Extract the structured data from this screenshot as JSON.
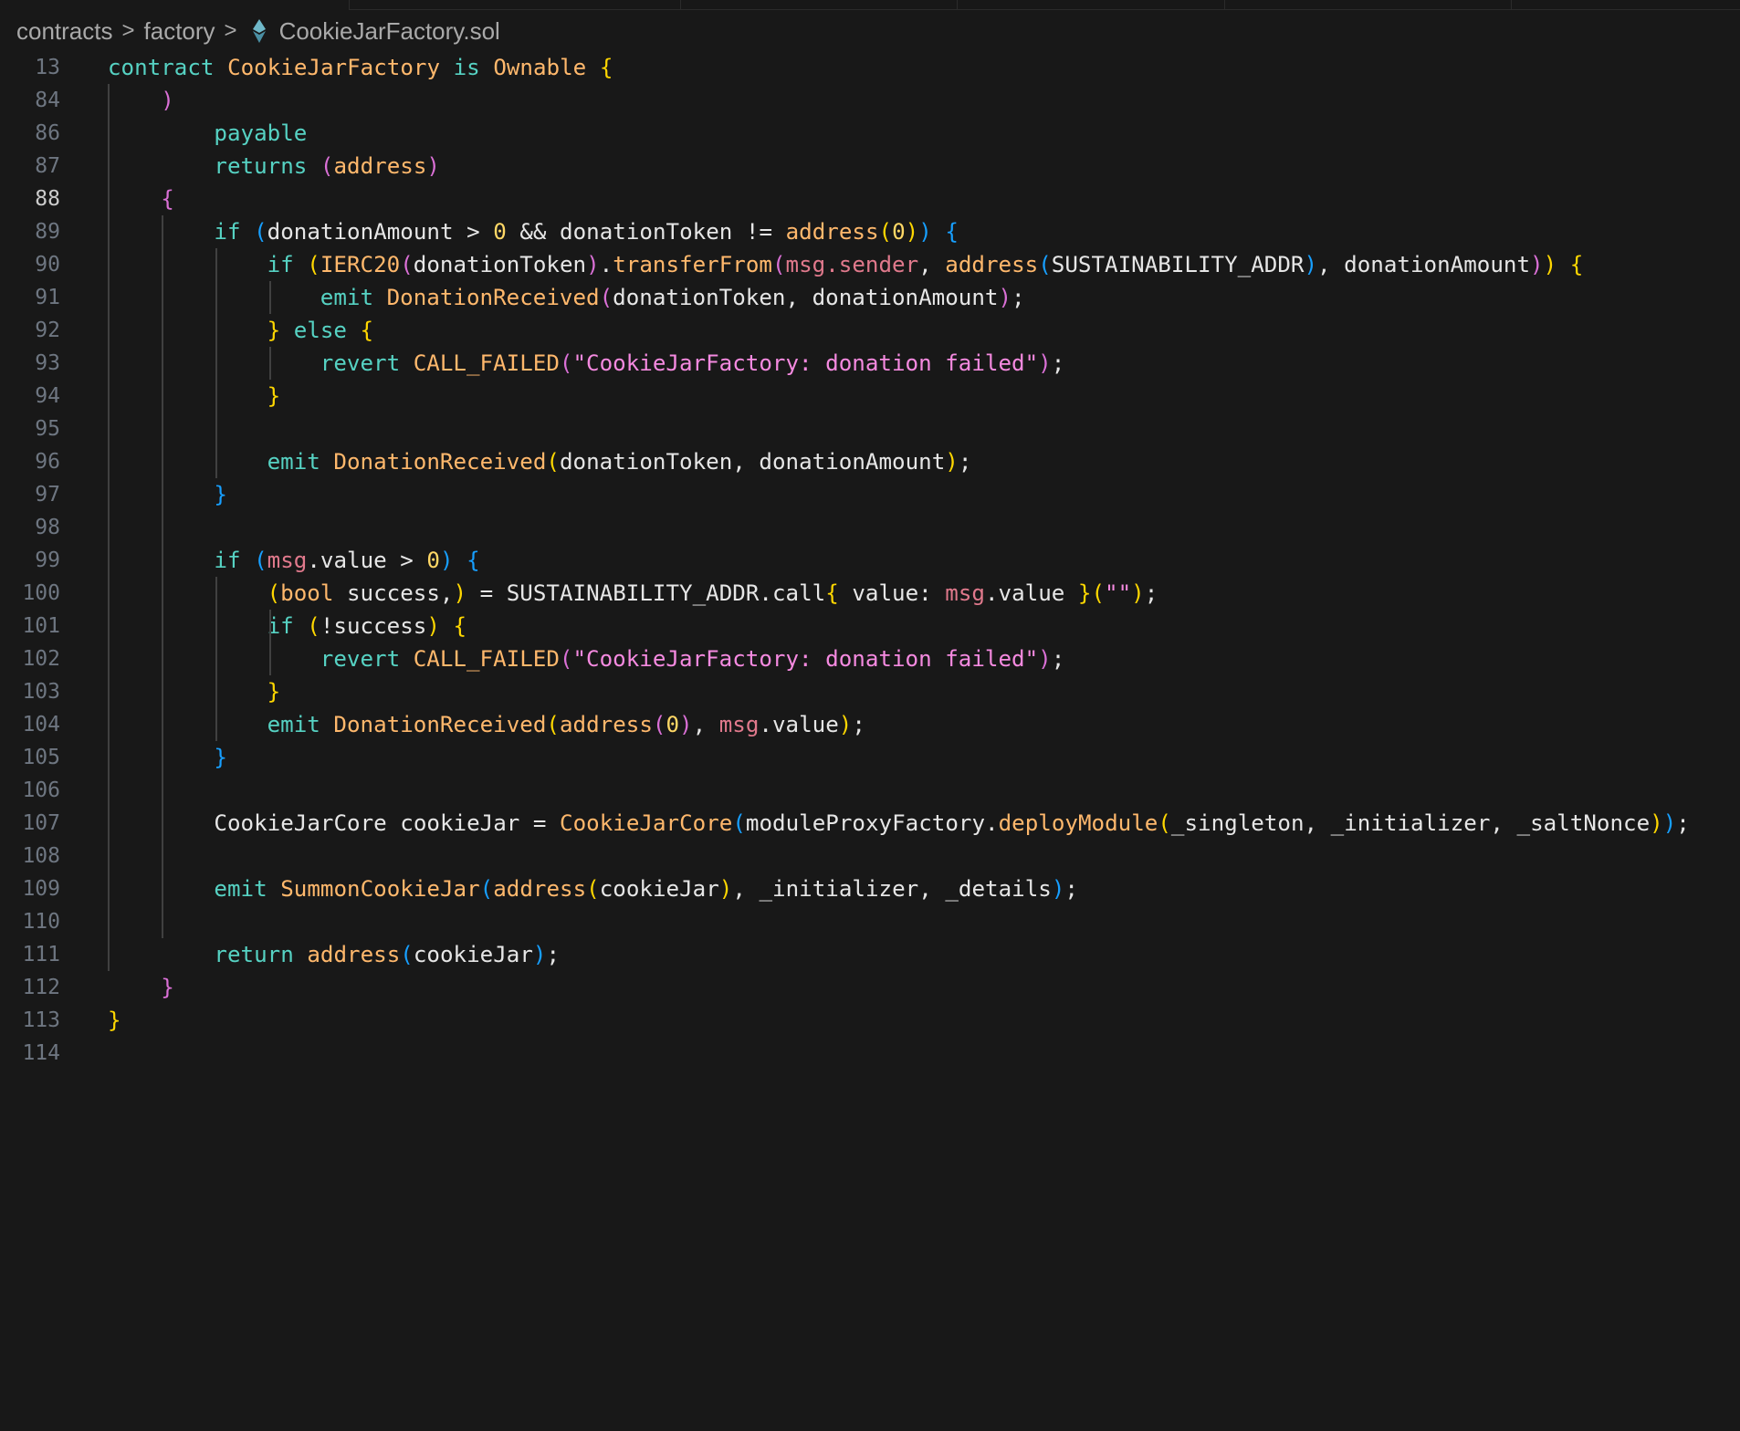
{
  "breadcrumb": {
    "segments": [
      "contracts",
      "factory"
    ],
    "file_name": "CookieJarFactory.sol",
    "separator": ">",
    "file_icon": "solidity-ethereum-icon"
  },
  "editor": {
    "active_line": "88",
    "lines": [
      {
        "n": "13",
        "indent": 0,
        "t": [
          [
            "contract ",
            "kw"
          ],
          [
            "CookieJarFactory ",
            "ty"
          ],
          [
            "is ",
            "kw"
          ],
          [
            "Ownable ",
            "ty"
          ],
          [
            "{",
            "b1"
          ]
        ]
      },
      {
        "n": "84",
        "indent": 2,
        "t": [
          [
            ")",
            "b2"
          ]
        ]
      },
      {
        "n": "86",
        "indent": 4,
        "t": [
          [
            "payable",
            "kw"
          ]
        ]
      },
      {
        "n": "87",
        "indent": 4,
        "t": [
          [
            "returns ",
            "kw"
          ],
          [
            "(",
            "b2"
          ],
          [
            "address",
            "ty"
          ],
          [
            ")",
            "b2"
          ]
        ]
      },
      {
        "n": "88",
        "indent": 2,
        "t": [
          [
            "{",
            "b2"
          ]
        ]
      },
      {
        "n": "89",
        "indent": 4,
        "t": [
          [
            "if ",
            "kw"
          ],
          [
            "(",
            "b3"
          ],
          [
            "donationAmount > ",
            "id"
          ],
          [
            "0",
            "nm"
          ],
          [
            " && donationToken != ",
            "id"
          ],
          [
            "address",
            "fn"
          ],
          [
            "(",
            "b1"
          ],
          [
            "0",
            "nm"
          ],
          [
            ")",
            "b1"
          ],
          [
            ")",
            "b3"
          ],
          [
            " ",
            "id"
          ],
          [
            "{",
            "b3"
          ]
        ]
      },
      {
        "n": "90",
        "indent": 6,
        "t": [
          [
            "if ",
            "kw"
          ],
          [
            "(",
            "b1"
          ],
          [
            "IERC20",
            "ty"
          ],
          [
            "(",
            "b2"
          ],
          [
            "donationToken",
            "id"
          ],
          [
            ")",
            "b2"
          ],
          [
            ".",
            "id"
          ],
          [
            "transferFrom",
            "fn"
          ],
          [
            "(",
            "b2"
          ],
          [
            "msg",
            "ms"
          ],
          [
            ".",
            "ms"
          ],
          [
            "sender",
            "ms"
          ],
          [
            ", ",
            "id"
          ],
          [
            "address",
            "fn"
          ],
          [
            "(",
            "b3"
          ],
          [
            "SUSTAINABILITY_ADDR",
            "id"
          ],
          [
            ")",
            "b3"
          ],
          [
            ", donationAmount",
            "id"
          ],
          [
            ")",
            "b2"
          ],
          [
            ")",
            "b1"
          ],
          [
            " ",
            "id"
          ],
          [
            "{",
            "b1"
          ]
        ]
      },
      {
        "n": "91",
        "indent": 8,
        "t": [
          [
            "emit ",
            "kw"
          ],
          [
            "DonationReceived",
            "fn"
          ],
          [
            "(",
            "b2"
          ],
          [
            "donationToken, donationAmount",
            "id"
          ],
          [
            ")",
            "b2"
          ],
          [
            ";",
            "id"
          ]
        ]
      },
      {
        "n": "92",
        "indent": 6,
        "t": [
          [
            "}",
            "b1"
          ],
          [
            " else ",
            "kw"
          ],
          [
            "{",
            "b1"
          ]
        ]
      },
      {
        "n": "93",
        "indent": 8,
        "t": [
          [
            "revert ",
            "kw"
          ],
          [
            "CALL_FAILED",
            "fn"
          ],
          [
            "(",
            "b2"
          ],
          [
            "\"CookieJarFactory: donation failed\"",
            "st"
          ],
          [
            ")",
            "b2"
          ],
          [
            ";",
            "id"
          ]
        ]
      },
      {
        "n": "94",
        "indent": 6,
        "t": [
          [
            "}",
            "b1"
          ]
        ]
      },
      {
        "n": "95",
        "indent": 0,
        "t": []
      },
      {
        "n": "96",
        "indent": 6,
        "t": [
          [
            "emit ",
            "kw"
          ],
          [
            "DonationReceived",
            "fn"
          ],
          [
            "(",
            "b1"
          ],
          [
            "donationToken, donationAmount",
            "id"
          ],
          [
            ")",
            "b1"
          ],
          [
            ";",
            "id"
          ]
        ]
      },
      {
        "n": "97",
        "indent": 4,
        "t": [
          [
            "}",
            "b3"
          ]
        ]
      },
      {
        "n": "98",
        "indent": 0,
        "t": []
      },
      {
        "n": "99",
        "indent": 4,
        "t": [
          [
            "if ",
            "kw"
          ],
          [
            "(",
            "b3"
          ],
          [
            "msg",
            "ms"
          ],
          [
            ".value > ",
            "id"
          ],
          [
            "0",
            "nm"
          ],
          [
            ")",
            "b3"
          ],
          [
            " ",
            "id"
          ],
          [
            "{",
            "b3"
          ]
        ]
      },
      {
        "n": "100",
        "indent": 6,
        "t": [
          [
            "(",
            "b1"
          ],
          [
            "bool ",
            "ty"
          ],
          [
            "success,",
            "id"
          ],
          [
            ")",
            "b1"
          ],
          [
            " = SUSTAINABILITY_ADDR.call",
            "id"
          ],
          [
            "{",
            "b1"
          ],
          [
            " value: ",
            "id"
          ],
          [
            "msg",
            "ms"
          ],
          [
            ".value ",
            "id"
          ],
          [
            "}",
            "b1"
          ],
          [
            "(",
            "b1"
          ],
          [
            "\"\"",
            "st"
          ],
          [
            ")",
            "b1"
          ],
          [
            ";",
            "id"
          ]
        ]
      },
      {
        "n": "101",
        "indent": 6,
        "t": [
          [
            "if ",
            "kw"
          ],
          [
            "(",
            "b1"
          ],
          [
            "!success",
            "id"
          ],
          [
            ")",
            "b1"
          ],
          [
            " ",
            "id"
          ],
          [
            "{",
            "b1"
          ]
        ]
      },
      {
        "n": "102",
        "indent": 8,
        "t": [
          [
            "revert ",
            "kw"
          ],
          [
            "CALL_FAILED",
            "fn"
          ],
          [
            "(",
            "b2"
          ],
          [
            "\"CookieJarFactory: donation failed\"",
            "st"
          ],
          [
            ")",
            "b2"
          ],
          [
            ";",
            "id"
          ]
        ]
      },
      {
        "n": "103",
        "indent": 6,
        "t": [
          [
            "}",
            "b1"
          ]
        ]
      },
      {
        "n": "104",
        "indent": 6,
        "t": [
          [
            "emit ",
            "kw"
          ],
          [
            "DonationReceived",
            "fn"
          ],
          [
            "(",
            "b1"
          ],
          [
            "address",
            "fn"
          ],
          [
            "(",
            "b2"
          ],
          [
            "0",
            "nm"
          ],
          [
            ")",
            "b2"
          ],
          [
            ", ",
            "id"
          ],
          [
            "msg",
            "ms"
          ],
          [
            ".value",
            "id"
          ],
          [
            ")",
            "b1"
          ],
          [
            ";",
            "id"
          ]
        ]
      },
      {
        "n": "105",
        "indent": 4,
        "t": [
          [
            "}",
            "b3"
          ]
        ]
      },
      {
        "n": "106",
        "indent": 0,
        "t": []
      },
      {
        "n": "107",
        "indent": 4,
        "t": [
          [
            "CookieJarCore cookieJar = ",
            "id"
          ],
          [
            "CookieJarCore",
            "fn"
          ],
          [
            "(",
            "b3"
          ],
          [
            "moduleProxyFactory.",
            "id"
          ],
          [
            "deployModule",
            "fn"
          ],
          [
            "(",
            "b1"
          ],
          [
            "_singleton, _initializer, _saltNonce",
            "id"
          ],
          [
            ")",
            "b1"
          ],
          [
            ")",
            "b3"
          ],
          [
            ";",
            "id"
          ]
        ]
      },
      {
        "n": "108",
        "indent": 0,
        "t": []
      },
      {
        "n": "109",
        "indent": 4,
        "t": [
          [
            "emit ",
            "kw"
          ],
          [
            "SummonCookieJar",
            "fn"
          ],
          [
            "(",
            "b3"
          ],
          [
            "address",
            "fn"
          ],
          [
            "(",
            "b1"
          ],
          [
            "cookieJar",
            "id"
          ],
          [
            ")",
            "b1"
          ],
          [
            ", _initializer, _details",
            "id"
          ],
          [
            ")",
            "b3"
          ],
          [
            ";",
            "id"
          ]
        ]
      },
      {
        "n": "110",
        "indent": 0,
        "t": []
      },
      {
        "n": "111",
        "indent": 4,
        "t": [
          [
            "return ",
            "kw"
          ],
          [
            "address",
            "fn"
          ],
          [
            "(",
            "b3"
          ],
          [
            "cookieJar",
            "id"
          ],
          [
            ")",
            "b3"
          ],
          [
            ";",
            "id"
          ]
        ]
      },
      {
        "n": "112",
        "indent": 2,
        "t": [
          [
            "}",
            "b2"
          ]
        ]
      },
      {
        "n": "113",
        "indent": 0,
        "t": [
          [
            "}",
            "b1"
          ]
        ]
      },
      {
        "n": "114",
        "indent": 0,
        "t": []
      }
    ]
  },
  "colors": {
    "background": "#181818",
    "keyword": "#56d2c3",
    "type_and_function": "#ffb86c",
    "number": "#ffd866",
    "string": "#f58ae0",
    "msg_member": "#e0798c",
    "bracket_gold": "#ffd700",
    "bracket_orchid": "#da70d6",
    "bracket_blue": "#179fff"
  }
}
